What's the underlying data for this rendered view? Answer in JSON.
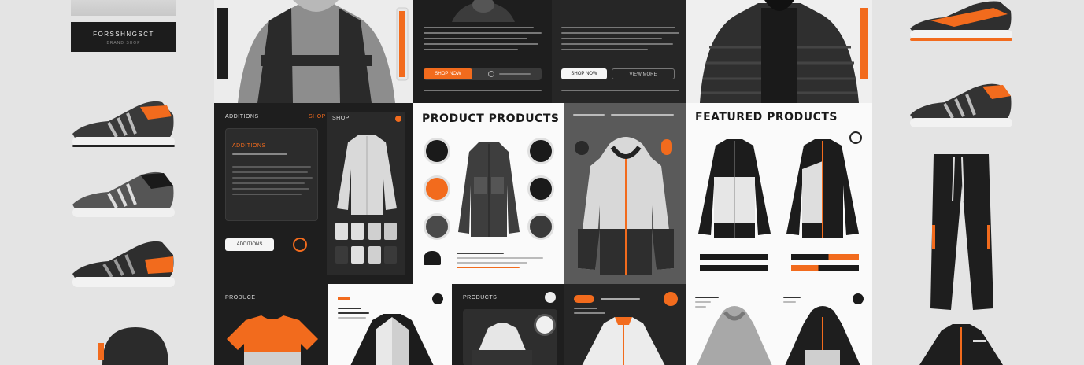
{
  "brand": {
    "logo_text": "FORSSHNGSCT",
    "logo_sub": "BRAND SHOP"
  },
  "colors": {
    "accent": "#f26b1d",
    "dark": "#1e1e1e",
    "light": "#f4f4f4"
  },
  "top_panels": {
    "panel_b_primary": "SHOP NOW",
    "panel_c_primary": "SHOP NOW",
    "panel_c_secondary": "VIEW MORE"
  },
  "row2": {
    "dark_panel_title": "ADDITIONS",
    "dark_panel_tag": "SHOP",
    "dark_card_title": "ADDITIONS",
    "dark_card_button": "ADDITIONS",
    "product_products_title": "PRODUCT PRODUCTS",
    "featured_products_title": "FEATURED PRODUCTS"
  },
  "row3": {
    "panel_a_title": "PRODUCE",
    "panel_c_title": "PRODUCTS"
  },
  "icons": [
    "gear-icon",
    "arrow-right-icon",
    "close-icon",
    "cart-icon"
  ]
}
